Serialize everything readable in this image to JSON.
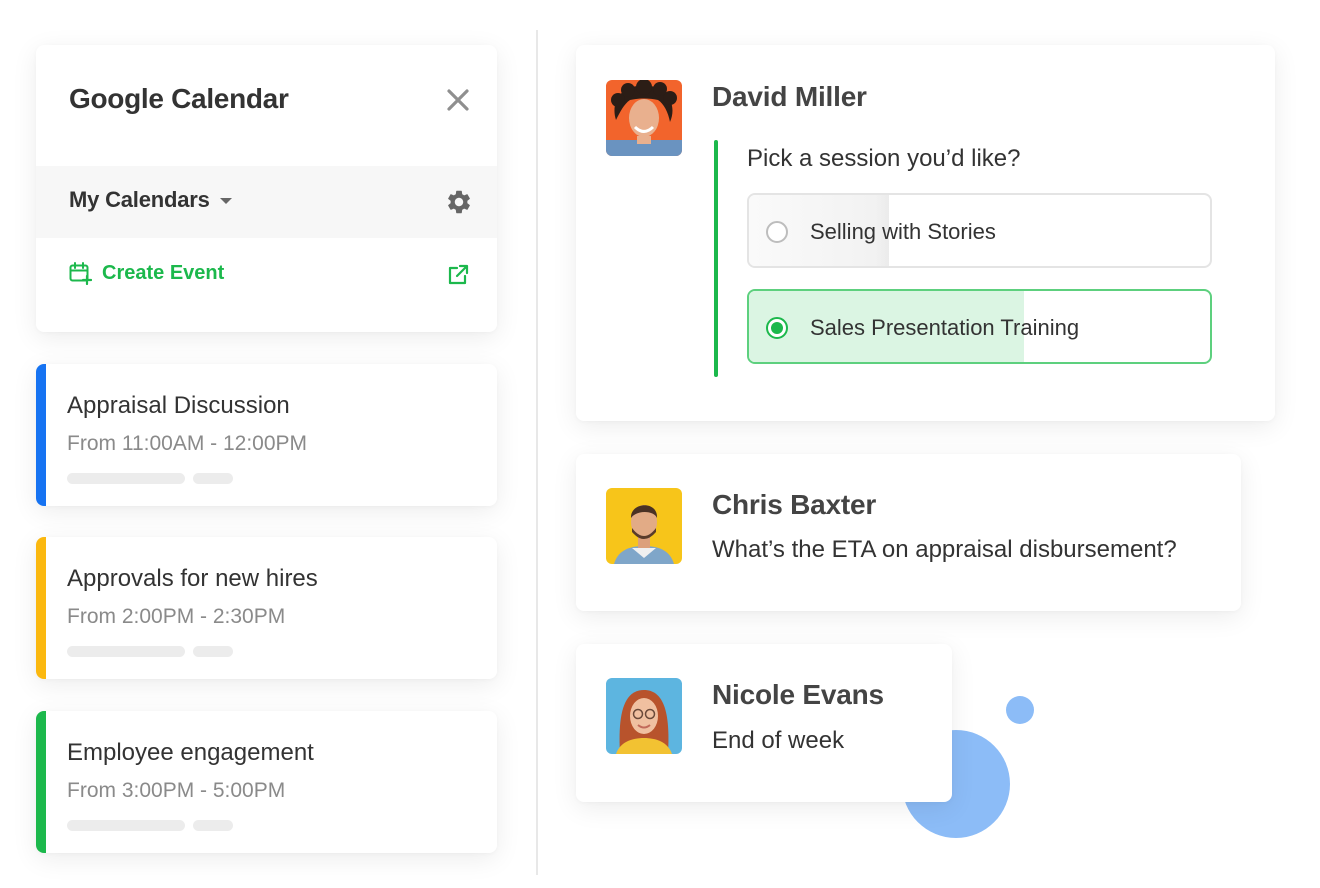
{
  "calendar_panel": {
    "title": "Google Calendar",
    "my_calendars_label": "My Calendars",
    "create_event_label": "Create Event",
    "accent_color": "#1cb84c"
  },
  "events": [
    {
      "title": "Appraisal Discussion",
      "time": "From 11:00AM - 12:00PM",
      "stripe_color": "#1673f2"
    },
    {
      "title": "Approvals for new hires",
      "time": "From 2:00PM - 2:30PM",
      "stripe_color": "#fbb80f"
    },
    {
      "title": "Employee engagement",
      "time": "From 3:00PM - 5:00PM",
      "stripe_color": "#1cb84c"
    }
  ],
  "messages": {
    "david": {
      "name": "David Miller",
      "question": "Pick a session you’d like?",
      "options": [
        {
          "label": "Selling with Stories",
          "selected": false
        },
        {
          "label": "Sales Presentation Training",
          "selected": true
        }
      ]
    },
    "chris": {
      "name": "Chris Baxter",
      "text": "What’s the ETA on appraisal disbursement?"
    },
    "nicole": {
      "name": "Nicole Evans",
      "text": "End of week"
    }
  },
  "icons": [
    "close-icon",
    "chevron-down-icon",
    "gear-icon",
    "calendar-plus-icon",
    "external-link-icon"
  ]
}
